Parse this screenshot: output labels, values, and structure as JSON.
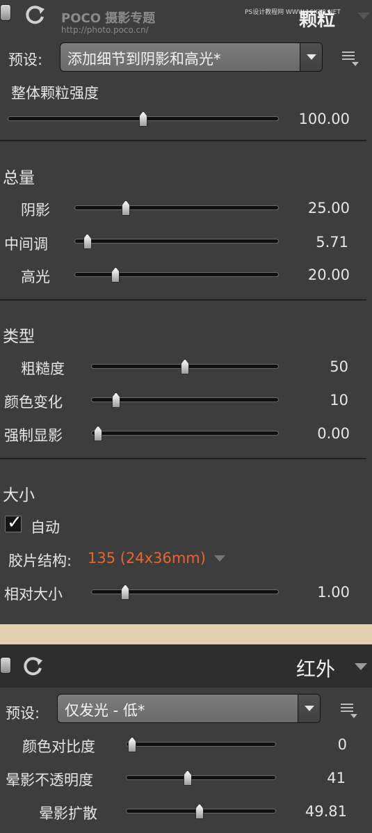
{
  "grain": {
    "title": "颗粒",
    "watermark_logo": "POCO 摄影专题",
    "watermark_url": "http://photo.poco.cn/",
    "watermark_corner": "PS设计教程网 WWW.16XX8.NET",
    "preset_label": "预设:",
    "preset_value": "添加细节到阴影和高光*",
    "overall": {
      "label": "整体颗粒强度",
      "value": "100.00",
      "fraction": 0.5
    },
    "amount": {
      "title": "总量",
      "sliders": [
        {
          "label": "阴影",
          "value": "25.00",
          "fraction": 0.25
        },
        {
          "label": "中间调",
          "value": "5.71",
          "fraction": 0.06
        },
        {
          "label": "高光",
          "value": "20.00",
          "fraction": 0.2
        }
      ]
    },
    "type": {
      "title": "类型",
      "sliders": [
        {
          "label": "粗糙度",
          "value": "50",
          "fraction": 0.5
        },
        {
          "label": "颜色变化",
          "value": "10",
          "fraction": 0.13
        },
        {
          "label": "强制显影",
          "value": "0.00",
          "fraction": 0.0
        }
      ]
    },
    "size": {
      "title": "大小",
      "auto_label": "自动",
      "auto_checked": true,
      "film_label": "胶片结构:",
      "film_value": "135 (24x36mm)",
      "relative": {
        "label": "相对大小",
        "value": "1.00",
        "fraction": 0.18
      }
    }
  },
  "infrared": {
    "title": "红外",
    "preset_label": "预设:",
    "preset_value": "仅发光 - 低*",
    "sliders": [
      {
        "label": "颜色对比度",
        "value": "0",
        "fraction": 0.0
      },
      {
        "label": "晕影不透明度",
        "value": "41",
        "fraction": 0.41
      },
      {
        "label": "晕影扩散",
        "value": "49.81",
        "fraction": 0.49
      }
    ]
  },
  "colors": {
    "accent_orange": "#e8662e",
    "panel_bg": "#3d3d3d",
    "divider_band": "#e3cfb1"
  }
}
